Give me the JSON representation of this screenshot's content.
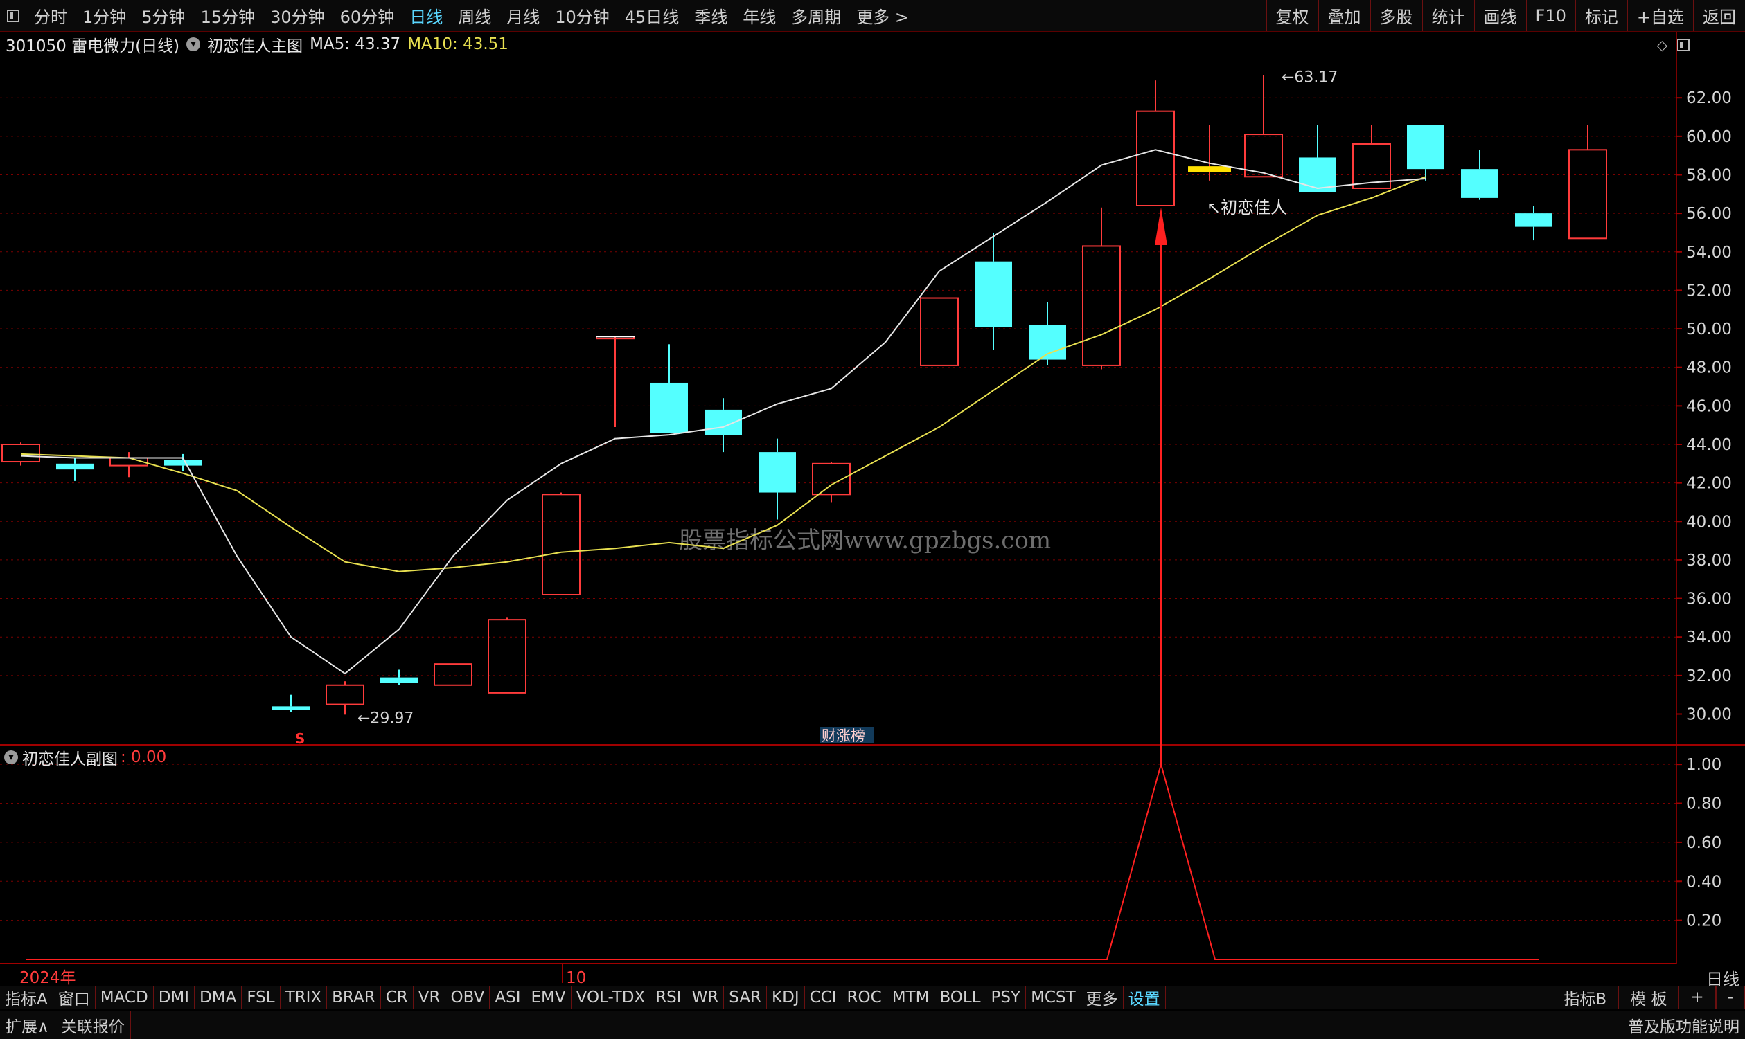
{
  "toolbar": {
    "periods": [
      "分时",
      "1分钟",
      "5分钟",
      "15分钟",
      "30分钟",
      "60分钟",
      "日线",
      "周线",
      "月线",
      "10分钟",
      "45日线",
      "季线",
      "年线",
      "多周期",
      "更多 >"
    ],
    "active_period": "日线",
    "right_buttons": [
      "复权",
      "叠加",
      "多股",
      "统计",
      "画线",
      "F10",
      "标记",
      "+自选",
      "返回"
    ]
  },
  "main_info": {
    "stock": "301050 雷电微力(日线)",
    "indicator": "初恋佳人主图",
    "ma5_label": "MA5: 43.37",
    "ma10_label": "MA10: 43.51"
  },
  "colors": {
    "up": "#ff3b3b",
    "down": "#54ffff",
    "ma5": "#e6e6e6",
    "ma10": "#e8e050",
    "grid": "#7a0000",
    "axis_text": "#d6d6d6",
    "signal_arrow": "#ff2020",
    "marker": "#ffe000",
    "watermark": "#8a8a8a"
  },
  "annotations": {
    "high_label": "63.17",
    "low_label": "29.97",
    "signal_label": "初恋佳人",
    "watermark": "股票指标公式网www.gpzbgs.com",
    "s_marker": "S",
    "news_marker": "财涨榜",
    "year_label": "2024年",
    "month_label": "10",
    "period_label": "日线"
  },
  "sub_info": {
    "name": "初恋佳人副图",
    "value": ": 0.00"
  },
  "indicator_tabs": [
    "指标A",
    "窗口",
    "MACD",
    "DMI",
    "DMA",
    "FSL",
    "TRIX",
    "BRAR",
    "CR",
    "VR",
    "OBV",
    "ASI",
    "EMV",
    "VOL-TDX",
    "RSI",
    "WR",
    "SAR",
    "KDJ",
    "CCI",
    "ROC",
    "MTM",
    "BOLL",
    "PSY",
    "MCST",
    "更多",
    "设置"
  ],
  "indicator_right": [
    "指标B",
    "模 板",
    "+",
    "-"
  ],
  "bottom_left": [
    "扩展∧",
    "关联报价"
  ],
  "bottom_right": "普及版功能说明",
  "chart_data": {
    "type": "candlestick",
    "price_axis": {
      "min": 28.4,
      "max": 64.2,
      "ticks": [
        "62.00",
        "60.00",
        "58.00",
        "56.00",
        "54.00",
        "52.00",
        "50.00",
        "48.00",
        "46.00",
        "44.00",
        "42.00",
        "40.00",
        "38.00",
        "36.00",
        "34.00",
        "32.00",
        "30.00"
      ]
    },
    "sub_axis": {
      "min": 0,
      "max": 1.1,
      "ticks": [
        "1.00",
        "0.80",
        "0.60",
        "0.40",
        "0.20"
      ]
    },
    "candles": [
      {
        "o": 43.1,
        "h": 44.1,
        "l": 42.9,
        "c": 44.0
      },
      {
        "o": 43.0,
        "h": 43.3,
        "l": 42.1,
        "c": 42.7
      },
      {
        "o": 42.9,
        "h": 43.6,
        "l": 42.3,
        "c": 43.3
      },
      {
        "o": 43.2,
        "h": 43.5,
        "l": 42.6,
        "c": 42.9
      },
      null,
      {
        "o": 30.4,
        "h": 31.0,
        "l": 30.1,
        "c": 30.2
      },
      {
        "o": 30.5,
        "h": 31.7,
        "l": 29.97,
        "c": 31.5
      },
      {
        "o": 31.9,
        "h": 32.3,
        "l": 31.5,
        "c": 31.6
      },
      {
        "o": 31.5,
        "h": 32.6,
        "l": 31.5,
        "c": 32.6
      },
      {
        "o": 31.1,
        "h": 35.0,
        "l": 31.1,
        "c": 34.9
      },
      {
        "o": 36.2,
        "h": 41.5,
        "l": 36.2,
        "c": 41.4
      },
      {
        "o": 49.6,
        "h": 49.6,
        "l": 44.9,
        "c": 49.6
      },
      {
        "o": 47.2,
        "h": 49.2,
        "l": 44.6,
        "c": 44.6
      },
      {
        "o": 45.8,
        "h": 46.4,
        "l": 43.6,
        "c": 44.5
      },
      {
        "o": 43.6,
        "h": 44.3,
        "l": 40.1,
        "c": 41.5
      },
      {
        "o": 41.4,
        "h": 43.1,
        "l": 41.0,
        "c": 43.0
      },
      null,
      {
        "o": 48.1,
        "h": 51.6,
        "l": 48.1,
        "c": 51.6
      },
      {
        "o": 53.5,
        "h": 55.0,
        "l": 48.9,
        "c": 50.1
      },
      {
        "o": 50.2,
        "h": 51.4,
        "l": 48.1,
        "c": 48.4
      },
      {
        "o": 48.1,
        "h": 56.3,
        "l": 47.9,
        "c": 54.3
      },
      {
        "o": 56.4,
        "h": 62.9,
        "l": 56.4,
        "c": 61.3
      },
      {
        "o": 58.3,
        "h": 60.6,
        "l": 57.7,
        "c": 58.3
      },
      {
        "o": 57.9,
        "h": 63.17,
        "l": 57.9,
        "c": 60.1
      },
      {
        "o": 58.9,
        "h": 60.6,
        "l": 57.1,
        "c": 57.1
      },
      {
        "o": 57.3,
        "h": 60.6,
        "l": 57.3,
        "c": 59.6
      },
      {
        "o": 60.6,
        "h": 60.6,
        "l": 57.7,
        "c": 58.3
      },
      {
        "o": 58.3,
        "h": 59.3,
        "l": 56.7,
        "c": 56.8
      },
      {
        "o": 56.0,
        "h": 56.4,
        "l": 54.6,
        "c": 55.3
      },
      {
        "o": 54.7,
        "h": 60.6,
        "l": 54.7,
        "c": 59.3
      }
    ],
    "ma5": [
      43.4,
      43.3,
      43.3,
      43.3,
      38.2,
      34.0,
      32.1,
      34.4,
      38.2,
      41.1,
      43.0,
      44.3,
      44.5,
      44.9,
      46.1,
      46.9,
      49.3,
      53.0,
      54.8,
      56.6,
      58.5,
      59.3,
      58.6,
      58.1,
      57.3,
      57.6,
      57.8
    ],
    "ma10": [
      43.5,
      43.4,
      43.3,
      42.5,
      41.6,
      39.7,
      37.9,
      37.4,
      37.6,
      37.9,
      38.4,
      38.6,
      38.9,
      38.6,
      39.8,
      41.9,
      43.4,
      44.9,
      46.8,
      48.7,
      49.7,
      51.0,
      52.6,
      54.3,
      55.9,
      56.8,
      57.9
    ],
    "ma_start_index": 0,
    "signal": [
      0,
      0,
      0,
      0,
      0,
      0,
      0,
      0,
      0,
      0,
      0,
      0,
      0,
      0,
      0,
      0,
      0,
      0,
      0,
      0,
      0,
      1,
      0,
      0,
      0,
      0,
      0,
      0,
      0,
      0
    ]
  }
}
